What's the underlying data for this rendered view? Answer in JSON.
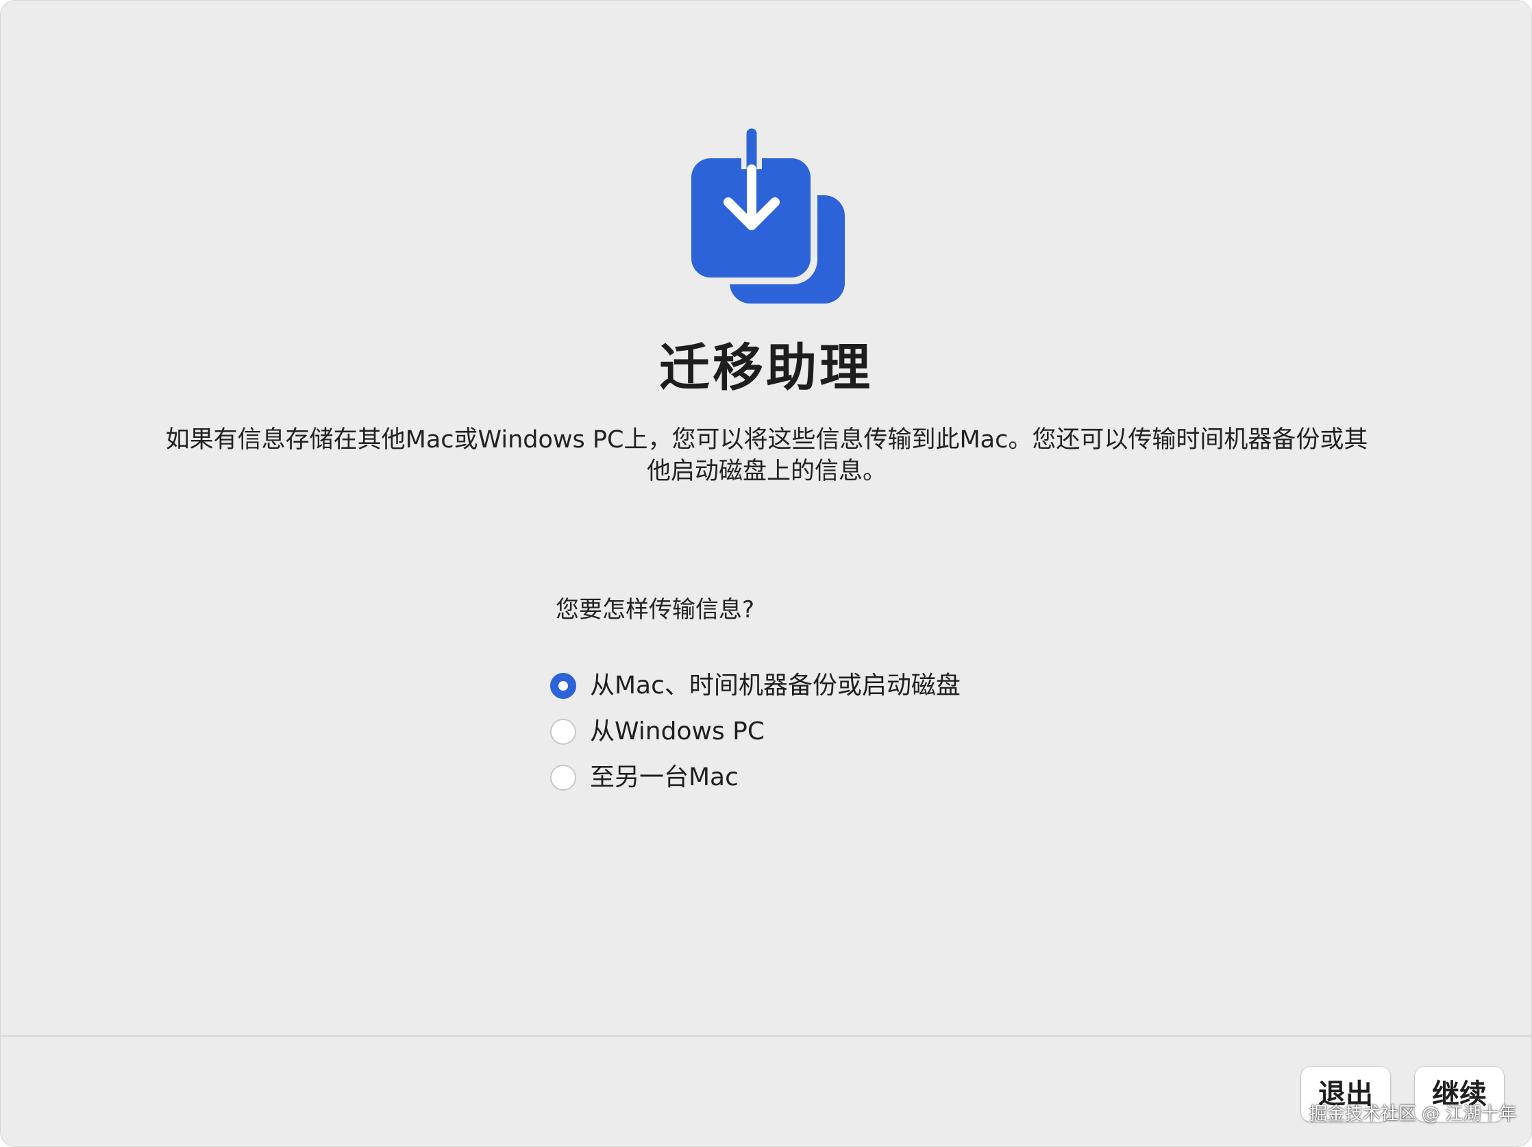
{
  "app": {
    "title": "迁移助理",
    "icon": "migration-download-icon",
    "accent_color": "#2d63d8"
  },
  "intro": {
    "description": "如果有信息存储在其他Mac或Windows PC上，您可以将这些信息传输到此Mac。您还可以传输时间机器备份或其他启动磁盘上的信息。"
  },
  "transfer": {
    "question": "您要怎样传输信息?",
    "options": [
      {
        "label": "从Mac、时间机器备份或启动磁盘",
        "selected": true
      },
      {
        "label": "从Windows PC",
        "selected": false
      },
      {
        "label": "至另一台Mac",
        "selected": false
      }
    ]
  },
  "footer": {
    "quit_label": "退出",
    "continue_label": "继续"
  },
  "watermark": {
    "text": "掘金技术社区 @ 江湖十年"
  }
}
